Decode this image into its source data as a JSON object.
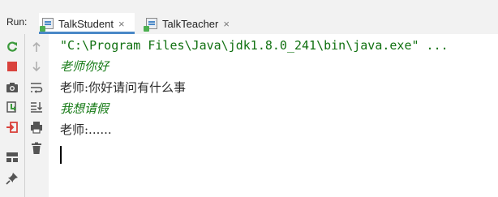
{
  "run_panel": {
    "label": "Run:",
    "tabs": [
      {
        "label": "TalkStudent",
        "active": true,
        "close": "×"
      },
      {
        "label": "TalkTeacher",
        "active": false,
        "close": "×"
      }
    ]
  },
  "toolbar": {
    "left_column": [
      "rerun-icon",
      "stop-icon",
      "camera-icon",
      "restore-layout-icon",
      "exit-icon",
      "layout-icon",
      "pin-icon"
    ],
    "right_column": [
      "up-arrow-icon",
      "down-arrow-icon",
      "soft-wrap-icon",
      "scroll-to-end-icon",
      "print-icon",
      "trash-icon"
    ]
  },
  "console": {
    "command": "\"C:\\Program Files\\Java\\jdk1.8.0_241\\bin\\java.exe\" ...",
    "lines": [
      {
        "text": "老师你好",
        "style": "input"
      },
      {
        "text": "老师:你好请问有什么事",
        "style": "output"
      },
      {
        "text": "我想请假",
        "style": "input"
      },
      {
        "text": "老师:......",
        "style": "output"
      }
    ]
  },
  "colors": {
    "accent": "#4a88c7",
    "input_text": "#157a15",
    "output_text": "#2a2a2a",
    "panel_bg": "#f2f2f2"
  }
}
